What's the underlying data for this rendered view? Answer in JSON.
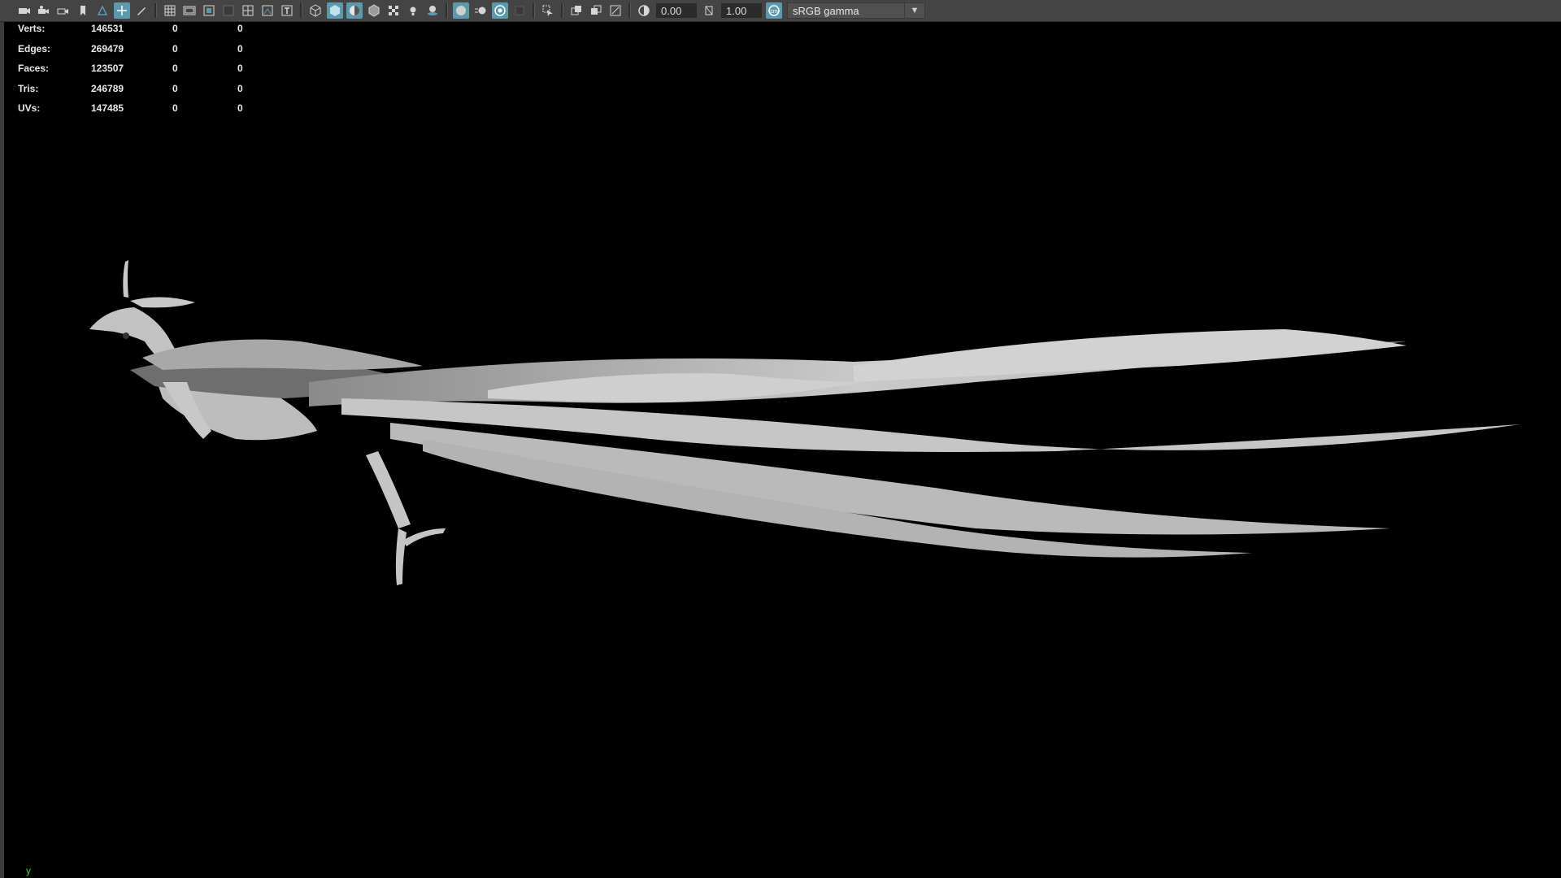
{
  "toolbar": {
    "exposure_value": "0.00",
    "gamma_value": "1.00",
    "color_space": "sRGB gamma",
    "icons": [
      "camera-icon",
      "camera-attributes-icon",
      "camera-lock-icon",
      "bookmark-icon",
      "image-plane-icon",
      "2d-pan-zoom-icon",
      "grease-pencil-icon",
      "grid-icon",
      "film-gate-icon",
      "resolution-gate-icon",
      "gate-mask-icon",
      "field-chart-icon",
      "safe-action-icon",
      "safe-title-icon",
      "wireframe-icon",
      "smooth-shade-icon",
      "wireframe-on-shaded-icon",
      "default-material-icon",
      "textured-icon",
      "lights-icon",
      "shadows-icon",
      "screen-space-ao-icon",
      "motion-blur-icon",
      "multisample-aa-icon",
      "depth-of-field-icon",
      "isolate-select-icon",
      "xray-icon",
      "xray-joints-icon",
      "xray-components-icon",
      "exposure-icon",
      "gamma-icon",
      "color-management-icon"
    ]
  },
  "hud": {
    "rows": [
      {
        "label": "Verts:",
        "v1": "146531",
        "v2": "0",
        "v3": "0"
      },
      {
        "label": "Edges:",
        "v1": "269479",
        "v2": "0",
        "v3": "0"
      },
      {
        "label": "Faces:",
        "v1": "123507",
        "v2": "0",
        "v3": "0"
      },
      {
        "label": "Tris:",
        "v1": "246789",
        "v2": "0",
        "v3": "0"
      },
      {
        "label": "UVs:",
        "v1": "147485",
        "v2": "0",
        "v3": "0"
      }
    ]
  },
  "axis_label": "y",
  "colors": {
    "toolbar_bg": "#444444",
    "active_icon": "#5d99ad",
    "viewport_bg": "#000000",
    "model_shade": "#c8c8c8",
    "axis_y": "#3bd43b"
  }
}
